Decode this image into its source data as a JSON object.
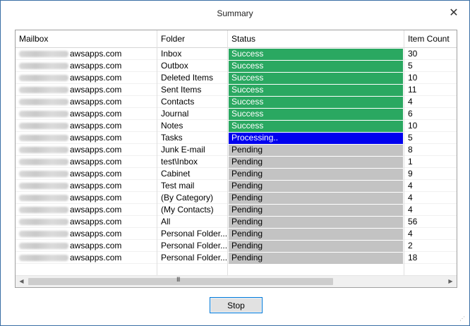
{
  "window": {
    "title": "Summary",
    "close_glyph": "✕"
  },
  "grid": {
    "columns": [
      "Mailbox",
      "Folder",
      "Status",
      "Item Count"
    ],
    "rows": [
      {
        "mailbox": "awsapps.com",
        "folder": "Inbox",
        "status": "Success",
        "count": "30"
      },
      {
        "mailbox": "awsapps.com",
        "folder": "Outbox",
        "status": "Success",
        "count": "5"
      },
      {
        "mailbox": "awsapps.com",
        "folder": "Deleted Items",
        "status": "Success",
        "count": "10"
      },
      {
        "mailbox": "awsapps.com",
        "folder": "Sent Items",
        "status": "Success",
        "count": "11"
      },
      {
        "mailbox": "awsapps.com",
        "folder": "Contacts",
        "status": "Success",
        "count": "4"
      },
      {
        "mailbox": "awsapps.com",
        "folder": "Journal",
        "status": "Success",
        "count": "6"
      },
      {
        "mailbox": "awsapps.com",
        "folder": "Notes",
        "status": "Success",
        "count": "10"
      },
      {
        "mailbox": "awsapps.com",
        "folder": "Tasks",
        "status": "Processing..",
        "count": "5"
      },
      {
        "mailbox": "awsapps.com",
        "folder": "Junk E-mail",
        "status": "Pending",
        "count": "8"
      },
      {
        "mailbox": "awsapps.com",
        "folder": "test\\Inbox",
        "status": "Pending",
        "count": "1"
      },
      {
        "mailbox": "awsapps.com",
        "folder": "Cabinet",
        "status": "Pending",
        "count": "9"
      },
      {
        "mailbox": "awsapps.com",
        "folder": "Test mail",
        "status": "Pending",
        "count": "4"
      },
      {
        "mailbox": "awsapps.com",
        "folder": "(By Category)",
        "status": "Pending",
        "count": "4"
      },
      {
        "mailbox": "awsapps.com",
        "folder": "(My Contacts)",
        "status": "Pending",
        "count": "4"
      },
      {
        "mailbox": "awsapps.com",
        "folder": "All",
        "status": "Pending",
        "count": "56"
      },
      {
        "mailbox": "awsapps.com",
        "folder": "Personal Folder...",
        "status": "Pending",
        "count": "4"
      },
      {
        "mailbox": "awsapps.com",
        "folder": "Personal Folder...",
        "status": "Pending",
        "count": "2"
      },
      {
        "mailbox": "awsapps.com",
        "folder": "Personal Folder...",
        "status": "Pending",
        "count": "18"
      }
    ],
    "status_colors": {
      "Success": {
        "bg": "#2aa861",
        "fg": "#ffffff"
      },
      "Processing..": {
        "bg": "#0000ee",
        "fg": "#ffffff"
      },
      "Pending": {
        "bg": "#c3c3c3",
        "fg": "#000000"
      }
    }
  },
  "scrollbar": {
    "left_arrow": "◀",
    "right_arrow": "▶",
    "grip": "III"
  },
  "buttons": {
    "stop_label": "Stop"
  }
}
